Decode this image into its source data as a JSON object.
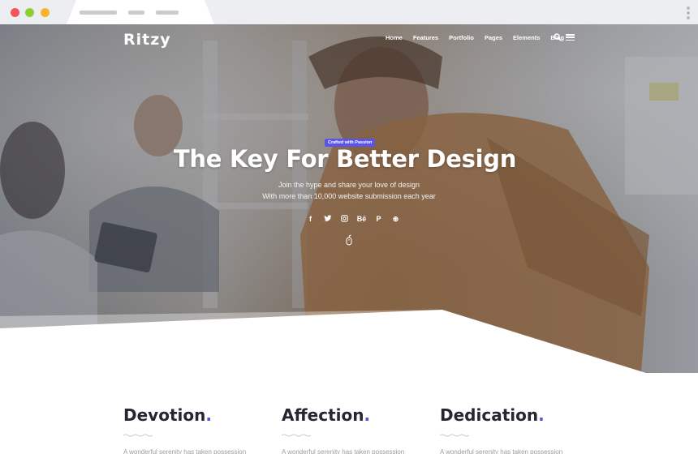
{
  "brand": {
    "logo": "Ritzy"
  },
  "nav": {
    "items": [
      "Home",
      "Features",
      "Portfolio",
      "Pages",
      "Elements",
      "Blog"
    ],
    "search_icon": "search-icon",
    "menu_icon": "hamburger-icon"
  },
  "hero": {
    "badge": "Crafted with Passion",
    "title": "The Key For Better Design",
    "subtitle_line1": "Join the hype and share your love of design",
    "subtitle_line2": "With more than 10,000 website submission each year",
    "socials": [
      {
        "icon": "facebook-icon",
        "glyph": "f"
      },
      {
        "icon": "twitter-icon",
        "glyph": "t"
      },
      {
        "icon": "instagram-icon",
        "glyph": "◎"
      },
      {
        "icon": "behance-icon",
        "glyph": "Bē"
      },
      {
        "icon": "pinterest-icon",
        "glyph": "P"
      },
      {
        "icon": "dribbble-icon",
        "glyph": "⊛"
      }
    ],
    "scroll_icon": "mouse-scroll-icon"
  },
  "features": [
    {
      "title": "Devotion",
      "dot": ".",
      "text": "A wonderful serenity has taken possession"
    },
    {
      "title": "Affection",
      "dot": ".",
      "text": "A wonderful serenity has taken possession"
    },
    {
      "title": "Dedication",
      "dot": ".",
      "text": "A wonderful serenity has taken possession"
    }
  ],
  "colors": {
    "accent": "#5a55e8",
    "title_dot": "#4b53d9",
    "heading": "#242633"
  }
}
